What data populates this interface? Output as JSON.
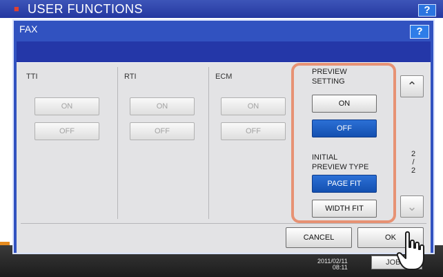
{
  "background": {
    "title": "USER FUNCTIONS",
    "help_label": "?",
    "time_line1": "2011/02/11",
    "time_line2": "08:11",
    "job_button_label": "JOB S"
  },
  "dialog": {
    "title": "FAX",
    "help_label": "?"
  },
  "columns": [
    {
      "label": "TTI",
      "on_label": "ON",
      "off_label": "OFF"
    },
    {
      "label": "RTI",
      "on_label": "ON",
      "off_label": "OFF"
    },
    {
      "label": "ECM",
      "on_label": "ON",
      "off_label": "OFF"
    }
  ],
  "preview_setting": {
    "label_line1": "PREVIEW",
    "label_line2": "SETTING",
    "on_label": "ON",
    "off_label": "OFF",
    "selected": "OFF"
  },
  "initial_preview_type": {
    "label_line1": "INITIAL",
    "label_line2": "PREVIEW TYPE",
    "page_fit_label": "PAGE FIT",
    "width_fit_label": "WIDTH FIT",
    "selected": "PAGE FIT"
  },
  "pagination": {
    "current": "2",
    "total": "2",
    "separator": "/"
  },
  "footer_buttons": {
    "cancel_label": "CANCEL",
    "ok_label": "OK"
  },
  "colors": {
    "accent_blue": "#1450b0",
    "highlight_orange": "#e79274",
    "header_blue": "#3152c0"
  }
}
